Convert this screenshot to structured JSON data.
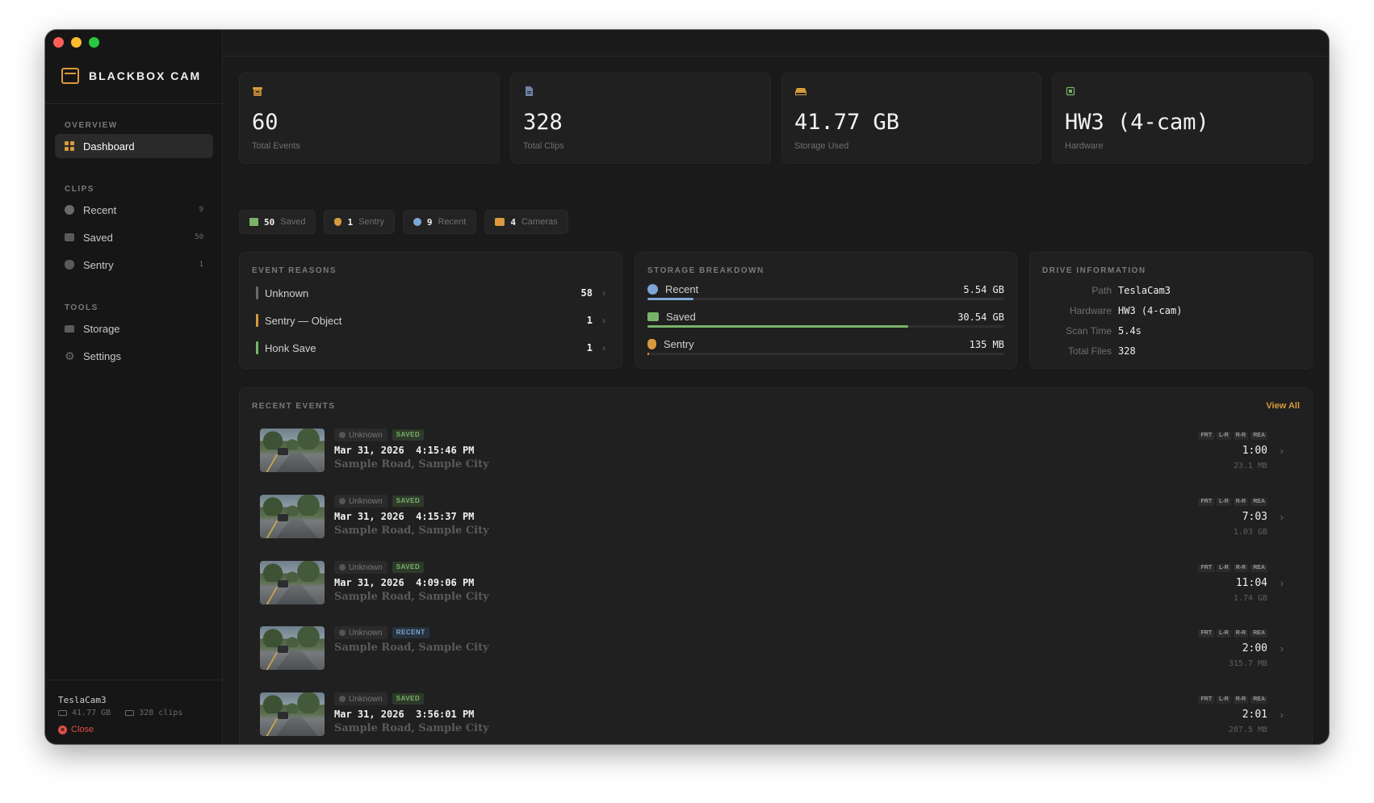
{
  "app": {
    "name": "BLACKBOX CAM"
  },
  "colors": {
    "accent": "#d89a3c",
    "saved": "#79b36a",
    "recent": "#7ea6d4",
    "danger": "#e0504a"
  },
  "sidebar": {
    "sections": {
      "overview": "OVERVIEW",
      "clips": "CLIPS",
      "tools": "TOOLS"
    },
    "dashboard": {
      "label": "Dashboard",
      "icon": "grid-icon"
    },
    "clips": [
      {
        "label": "Recent",
        "count": "9",
        "icon": "clock-icon"
      },
      {
        "label": "Saved",
        "count": "50",
        "icon": "folder-icon"
      },
      {
        "label": "Sentry",
        "count": "1",
        "icon": "shield-icon"
      }
    ],
    "tools": [
      {
        "label": "Storage",
        "icon": "drive-icon"
      },
      {
        "label": "Settings",
        "icon": "gear-icon"
      }
    ],
    "footer": {
      "name": "TeslaCam3",
      "storage": "41.77 GB",
      "clips": "328 clips",
      "close": "Close"
    }
  },
  "stats": [
    {
      "value": "60",
      "label": "Total Events",
      "icon": "archive-icon"
    },
    {
      "value": "328",
      "label": "Total Clips",
      "icon": "file-icon"
    },
    {
      "value": "41.77 GB",
      "label": "Storage Used",
      "icon": "drive-icon"
    },
    {
      "value": "HW3 (4-cam)",
      "label": "Hardware",
      "icon": "chip-icon"
    }
  ],
  "pills": [
    {
      "num": "50",
      "label": "Saved",
      "icon": "folder-icon"
    },
    {
      "num": "1",
      "label": "Sentry",
      "icon": "shield-icon"
    },
    {
      "num": "9",
      "label": "Recent",
      "icon": "clock-icon"
    },
    {
      "num": "4",
      "label": "Cameras",
      "icon": "camera-icon"
    }
  ],
  "event_reasons": {
    "title": "EVENT REASONS",
    "items": [
      {
        "label": "Unknown",
        "count": "58",
        "color": "#6a6a6a"
      },
      {
        "label": "Sentry — Object",
        "count": "1",
        "color": "#d89a3c"
      },
      {
        "label": "Honk Save",
        "count": "1",
        "color": "#79b36a"
      }
    ]
  },
  "storage_breakdown": {
    "title": "STORAGE BREAKDOWN",
    "items": [
      {
        "label": "Recent",
        "value": "5.54 GB",
        "fraction": 0.13,
        "color": "#7ea6d4",
        "icon": "clock-icon"
      },
      {
        "label": "Saved",
        "value": "30.54 GB",
        "fraction": 0.73,
        "color": "#79b36a",
        "icon": "folder-icon"
      },
      {
        "label": "Sentry",
        "value": "135 MB",
        "fraction": 0.004,
        "color": "#d89a3c",
        "icon": "shield-icon"
      }
    ]
  },
  "drive_info": {
    "title": "DRIVE INFORMATION",
    "items": [
      {
        "key": "Path",
        "value": "TeslaCam3"
      },
      {
        "key": "Hardware",
        "value": "HW3 (4-cam)"
      },
      {
        "key": "Scan Time",
        "value": "5.4s"
      },
      {
        "key": "Total Files",
        "value": "328"
      }
    ]
  },
  "recent_events": {
    "title": "RECENT EVENTS",
    "view_all": "View All",
    "cameras": [
      "FRT",
      "L-R",
      "R-R",
      "REA"
    ],
    "items": [
      {
        "reason": "Unknown",
        "tag": "SAVED",
        "time": "Mar 31, 2026  4:15:46 PM",
        "location": "Sample Road, Sample City",
        "duration": "1:00",
        "size": "23.1 MB"
      },
      {
        "reason": "Unknown",
        "tag": "SAVED",
        "time": "Mar 31, 2026  4:15:37 PM",
        "location": "Sample Road, Sample City",
        "duration": "7:03",
        "size": "1.03 GB"
      },
      {
        "reason": "Unknown",
        "tag": "SAVED",
        "time": "Mar 31, 2026  4:09:06 PM",
        "location": "Sample Road, Sample City",
        "duration": "11:04",
        "size": "1.74 GB"
      },
      {
        "reason": "Unknown",
        "tag": "RECENT",
        "time": "",
        "location": "Sample Road, Sample City",
        "duration": "2:00",
        "size": "315.7 MB"
      },
      {
        "reason": "Unknown",
        "tag": "SAVED",
        "time": "Mar 31, 2026  3:56:01 PM",
        "location": "Sample Road, Sample City",
        "duration": "2:01",
        "size": "207.5 MB"
      }
    ]
  }
}
